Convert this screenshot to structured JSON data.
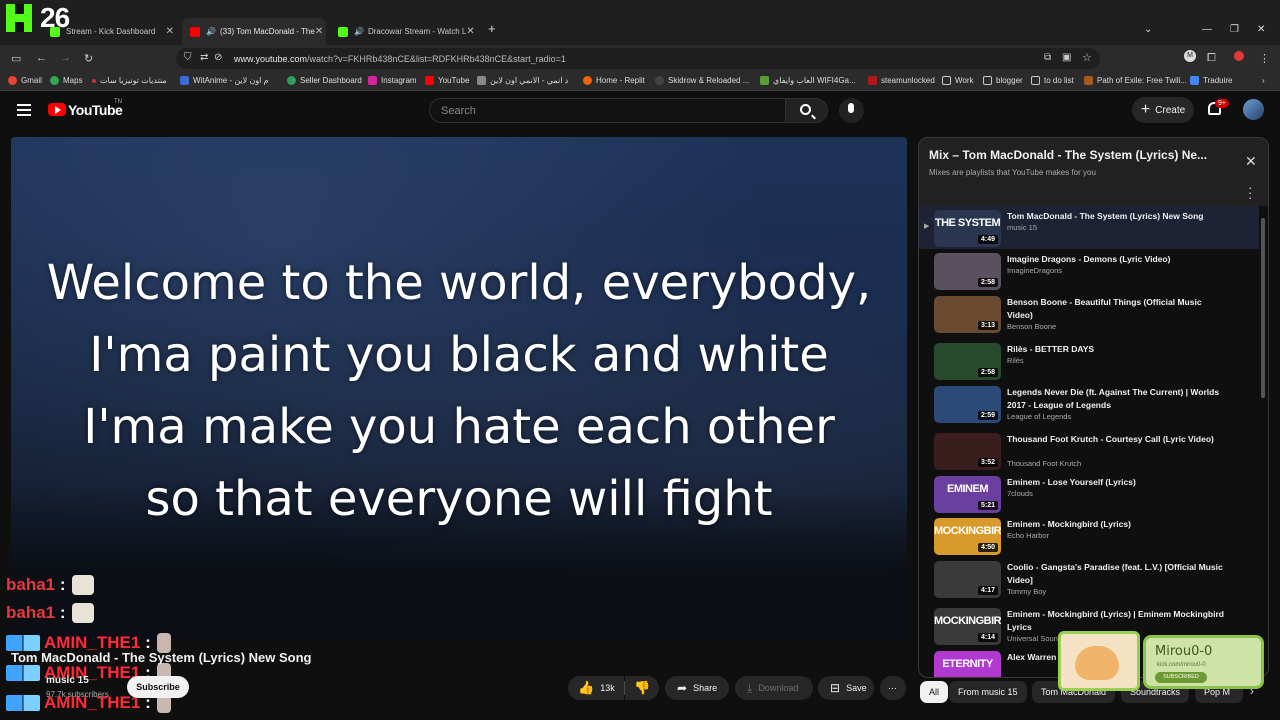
{
  "overlay": {
    "stream_count": "26"
  },
  "tabs": [
    {
      "title": "Stream - Kick Dashboard",
      "color": "#53fc18"
    },
    {
      "title": "(33) Tom MacDonald - The",
      "color": "#ff0000"
    },
    {
      "title": "Dracowar Stream - Watch L",
      "color": "#53fc18"
    }
  ],
  "address_bar": {
    "host": "www.youtube.com",
    "path": "/watch?v=FKHRb438nCE&list=RDFKHRb438nCE&start_radio=1"
  },
  "bookmarks": [
    {
      "label": "Gmail",
      "color": "#ea4335"
    },
    {
      "label": "Maps",
      "color": "#34a853"
    },
    {
      "label": "منتديات تونيزيا سات",
      "color": "#cc3333"
    },
    {
      "label": "WitAnime - م اون لاين",
      "color": "#3b6ad6"
    },
    {
      "label": "Seller Dashboard",
      "color": "#2e9e5b"
    },
    {
      "label": "Instagram",
      "color": "#d6249f"
    },
    {
      "label": "YouTube",
      "color": "#ff0000"
    },
    {
      "label": "د انمي - الانمي اون لاين",
      "color": "#888888"
    },
    {
      "label": "Home - Replit",
      "color": "#f26207"
    },
    {
      "label": "Skidrow & Reloaded ...",
      "color": "#444444"
    },
    {
      "label": "العاب وايفاي WIFI4Ga...",
      "color": "#5a9e3a"
    },
    {
      "label": "steamunlocked",
      "color": "#b01818"
    },
    {
      "label": "Work",
      "color": "#c9c9c9"
    },
    {
      "label": "blogger",
      "color": "#c9c9c9"
    },
    {
      "label": "to do list",
      "color": "#c9c9c9"
    },
    {
      "label": "Path of Exile: Free Twili...",
      "color": "#a45a1c"
    },
    {
      "label": "Traduire",
      "color": "#4285f4"
    }
  ],
  "header": {
    "logo": "YouTube",
    "logo_suffix": "TN",
    "search_placeholder": "Search",
    "create_label": "Create",
    "notif_badge": "9+"
  },
  "video": {
    "lyrics": [
      "Welcome to the world, everybody,",
      "I'ma paint you black and white",
      "I'ma make you hate each other",
      "so that everyone will fight"
    ],
    "title": "Tom MacDonald - The System (Lyrics) New Song",
    "channel": "music 15",
    "subscribers": "97.7k subscribers",
    "subscribe_label": "Subscribe",
    "likes": "13k",
    "share_label": "Share",
    "download_label": "Download",
    "save_label": "Save"
  },
  "chat": [
    {
      "user": "baha1",
      "sep": ":"
    },
    {
      "user": "baha1",
      "sep": ":"
    },
    {
      "user": "AMIN_THE1",
      "sep": ":"
    },
    {
      "user": "AMIN_THE1",
      "sep": ":"
    },
    {
      "user": "AMIN_THE1",
      "sep": ":"
    }
  ],
  "playlist": {
    "title": "Mix – Tom MacDonald - The System (Lyrics) Ne...",
    "subtitle": "Mixes are playlists that YouTube makes for you",
    "items": [
      {
        "title": "Tom MacDonald - The System (Lyrics) New Song",
        "channel": "music 15",
        "duration": "4:49",
        "thumb_text": "THE SYSTEM",
        "thumb_color": "#2a3550",
        "active": true
      },
      {
        "title": "Imagine Dragons - Demons (Lyric Video)",
        "channel": "ImagineDragons",
        "duration": "2:58",
        "thumb_text": "",
        "thumb_color": "#5a5060"
      },
      {
        "title": "Benson Boone - Beautiful Things (Official Music Video)",
        "channel": "Benson Boone",
        "duration": "3:13",
        "thumb_text": "",
        "thumb_color": "#6a4a30"
      },
      {
        "title": "Rilès - BETTER DAYS",
        "channel": "Rilès",
        "duration": "2:58",
        "thumb_text": "",
        "thumb_color": "#274a2a"
      },
      {
        "title": "Legends Never Die (ft. Against The Current) | Worlds 2017 - League of Legends",
        "channel": "League of Legends",
        "duration": "2:59",
        "thumb_text": "",
        "thumb_color": "#2c4a78"
      },
      {
        "title": "Thousand Foot Krutch - Courtesy Call (Lyric Video)",
        "channel": "Thousand Foot Krutch",
        "duration": "3:52",
        "thumb_text": "",
        "thumb_color": "#3a1e1e"
      },
      {
        "title": "Eminem - Lose Yourself (Lyrics)",
        "channel": "7clouds",
        "duration": "5:21",
        "thumb_text": "EMINEM",
        "thumb_color": "#6a3fa0"
      },
      {
        "title": "Eminem - Mockingbird (Lyrics)",
        "channel": "Echo Harbor",
        "duration": "4:50",
        "thumb_text": "MOCKINGBIRD",
        "thumb_color": "#d89a2a"
      },
      {
        "title": "Coolio - Gangsta's Paradise (feat. L.V.) [Official Music Video]",
        "channel": "Tommy Boy",
        "duration": "4:17",
        "thumb_text": "",
        "thumb_color": "#3a3a3a"
      },
      {
        "title": "Eminem - Mockingbird (Lyrics) | Eminem Mockingbird Lyrics",
        "channel": "Universal Sound",
        "duration": "4:14",
        "thumb_text": "MOCKINGBIRD",
        "thumb_color": "#3a3a3a"
      },
      {
        "title": "Alex Warren - ",
        "channel": "",
        "duration": "",
        "thumb_text": "ETERNITY",
        "thumb_color": "#b03ad0"
      }
    ]
  },
  "chips": [
    "All",
    "From music 15",
    "Tom MacDonald",
    "Soundtracks",
    "Pop M"
  ],
  "stream_overlay": {
    "name": "Mirou0-0",
    "link": "kick.com/mirou0-0",
    "badge": "SUBSCRIBED"
  }
}
